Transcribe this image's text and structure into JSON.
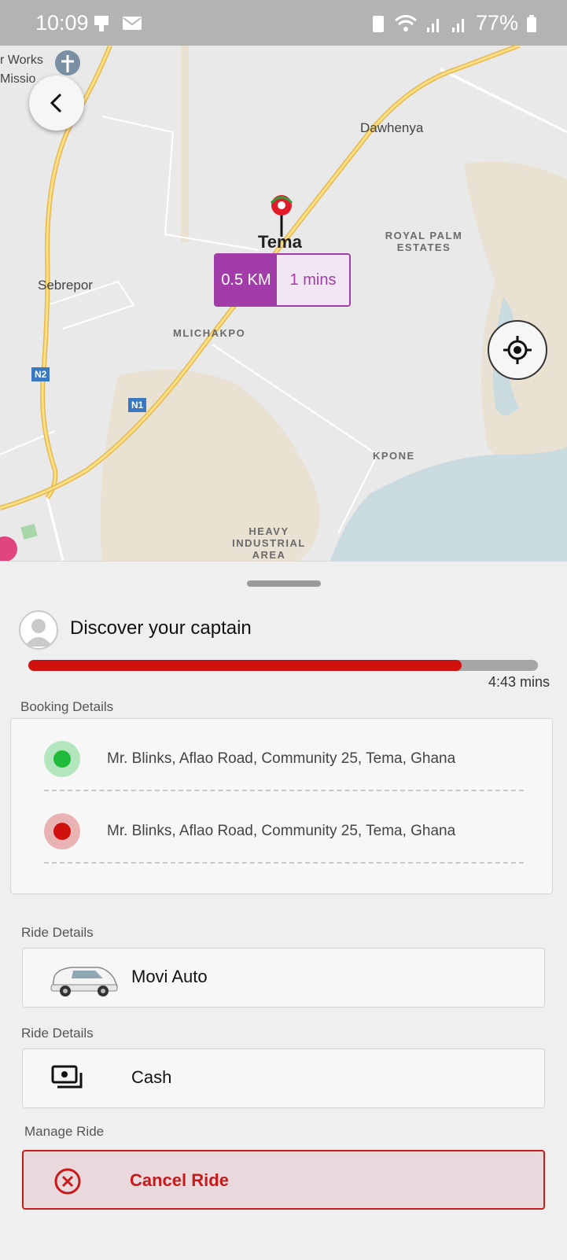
{
  "status_bar": {
    "time": "10:09",
    "battery": "77%"
  },
  "map": {
    "labels": {
      "works": "r Works",
      "mission": "Missio",
      "dawhenya": "Dawhenya",
      "royal_palm": "ROYAL PALM ESTATES",
      "sebrepor": "Sebrepor",
      "mlichakpo": "MLICHAKPO",
      "kpone": "KPONE",
      "heavy_industrial": "HEAVY INDUSTRIAL AREA",
      "n1": "N1",
      "n2": "N2"
    },
    "pin_label": "Tema",
    "eta": {
      "distance": "0.5 KM",
      "time": "1 mins"
    }
  },
  "sheet": {
    "title": "Discover your captain",
    "progress_fraction": 0.85,
    "timer": "4:43 mins",
    "booking_label": "Booking Details",
    "stops": [
      {
        "address": "Mr. Blinks, Aflao Road, Community 25, Tema, Ghana",
        "color": "#1fbb3a"
      },
      {
        "address": "Mr. Blinks, Aflao Road, Community 25, Tema, Ghana",
        "color": "#d0110e"
      }
    ],
    "ride_label": "Ride Details",
    "ride_type": "Movi Auto",
    "payment_label": "Ride Details",
    "payment_method": "Cash",
    "manage_label": "Manage Ride",
    "cancel_label": "Cancel Ride"
  },
  "colors": {
    "accent_red": "#d0110e",
    "eta_purple": "#a23ca8"
  }
}
